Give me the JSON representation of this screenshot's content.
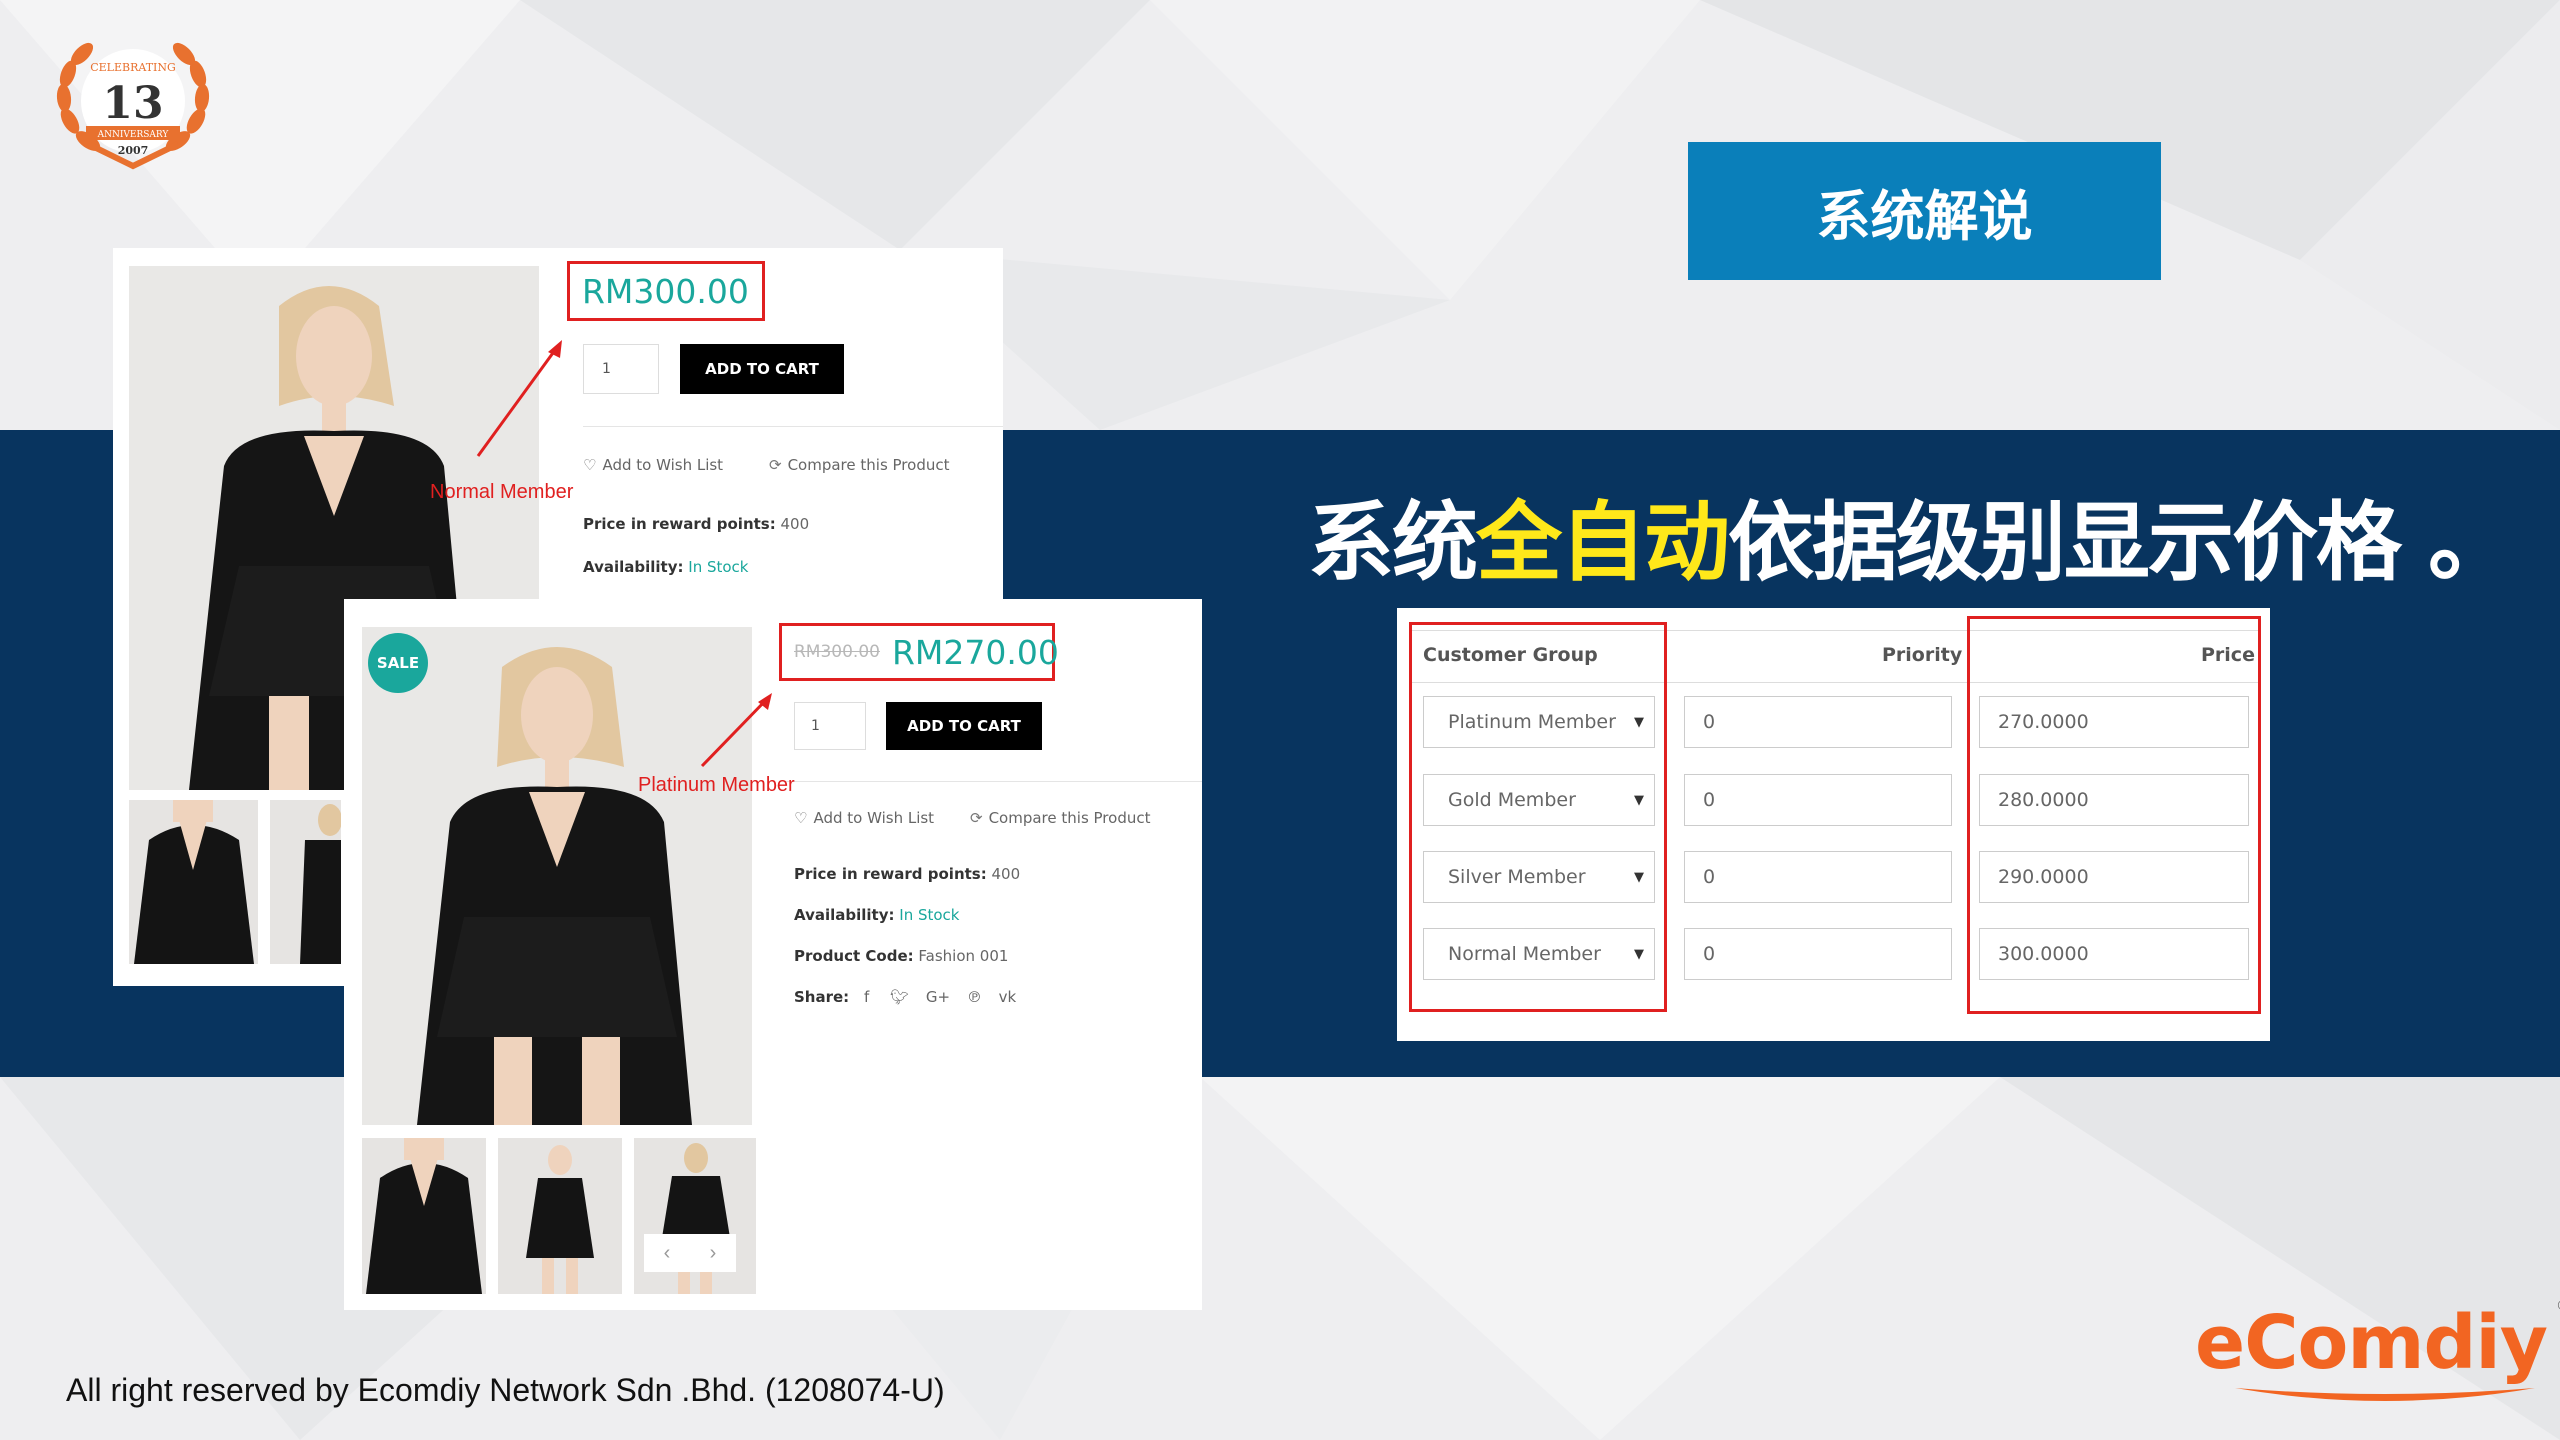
{
  "logo": {
    "arc_text": "CELEBRATING",
    "number": "13",
    "ribbon_text": "ANNIVERSARY",
    "year": "2007"
  },
  "header": {
    "title": "系统解说"
  },
  "headline": {
    "part1": "系统",
    "highlight": "全自动",
    "part2": "依据级别显示价格 。"
  },
  "normal_card": {
    "price": "RM300.00",
    "qty": "1",
    "add_to_cart": "ADD TO CART",
    "wish_list": "Add to Wish List",
    "compare": "Compare this Product",
    "reward_label": "Price in reward points:",
    "reward_value": "400",
    "availability_label": "Availability:",
    "availability_value": "In Stock",
    "annotation": "Normal Member"
  },
  "platinum_card": {
    "sale_badge": "SALE",
    "old_price": "RM300.00",
    "price": "RM270.00",
    "qty": "1",
    "add_to_cart": "ADD TO CART",
    "wish_list": "Add to Wish List",
    "compare": "Compare this Product",
    "reward_label": "Price in reward points:",
    "reward_value": "400",
    "availability_label": "Availability:",
    "availability_value": "In Stock",
    "code_label": "Product Code:",
    "code_value": "Fashion 001",
    "share_label": "Share:",
    "annotation": "Platinum Member"
  },
  "price_table": {
    "headers": {
      "group": "Customer Group",
      "priority": "Priority",
      "price": "Price"
    },
    "rows": [
      {
        "group": "Platinum Member",
        "priority": "0",
        "price": "270.0000"
      },
      {
        "group": "Gold Member",
        "priority": "0",
        "price": "280.0000"
      },
      {
        "group": "Silver Member",
        "priority": "0",
        "price": "290.0000"
      },
      {
        "group": "Normal Member",
        "priority": "0",
        "price": "300.0000"
      }
    ]
  },
  "brand": {
    "name": "eComdiy",
    "reg": "®"
  },
  "footer": {
    "text": "All right reserved by Ecomdiy Network Sdn .Bhd. (1208074-U)"
  },
  "colors": {
    "band": "#08345f",
    "header_box": "#0a7fba",
    "highlight": "#ffe81a",
    "price_teal": "#1aa79c",
    "annotation_red": "#e02020",
    "brand_orange": "#f26522"
  }
}
